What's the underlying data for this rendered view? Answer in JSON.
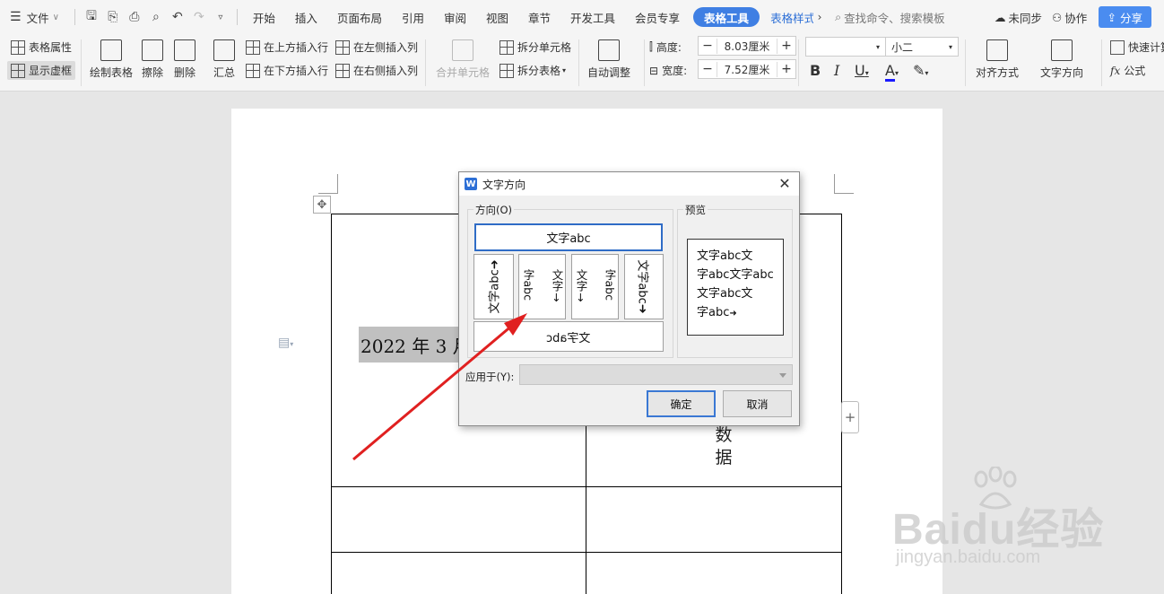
{
  "menubar": {
    "file_label": "文件",
    "tabs": [
      "开始",
      "插入",
      "页面布局",
      "引用",
      "审阅",
      "视图",
      "章节",
      "开发工具",
      "会员专享"
    ],
    "active_tab": "表格工具",
    "next_tab": "表格样式",
    "search_placeholder": "查找命令、搜索模板",
    "sync_label": "未同步",
    "collab_label": "协作",
    "share_label": "分享"
  },
  "ribbon": {
    "table_props": "表格属性",
    "show_gridlines": "显示虚框",
    "draw_table": "绘制表格",
    "erase": "擦除",
    "delete": "删除",
    "summary": "汇总",
    "insert_above": "在上方插入行",
    "insert_below": "在下方插入行",
    "insert_left": "在左侧插入列",
    "insert_right": "在右侧插入列",
    "merge_cells": "合并单元格",
    "split_cells": "拆分单元格",
    "split_table": "拆分表格",
    "auto_adjust": "自动调整",
    "height_label": "高度:",
    "height_value": "8.03厘米",
    "width_label": "宽度:",
    "width_value": "7.52厘米",
    "font_name": "",
    "font_size": "小二",
    "align": "对齐方式",
    "text_direction": "文字方向",
    "quick_calc": "快速计算",
    "formula": "公式"
  },
  "document": {
    "selected_text": "2022 年 3 月",
    "vertical_text": [
      "数",
      "据"
    ]
  },
  "dialog": {
    "title": "文字方向",
    "direction_group": "方向(O)",
    "preview_group": "预览",
    "opt_horizontal": "文字abc",
    "opt_rot_left": "文字abc",
    "opt_vert_col1": "文字",
    "opt_vert_col2": "字abc",
    "opt_vert2_col1": "文字",
    "opt_vert2_col2": "字abc",
    "opt_rot_right": "文字abc",
    "opt_mirror": "文字abc",
    "preview_lines": [
      "文字abc文",
      "字abc文字abc",
      "文字abc文",
      "字abc"
    ],
    "apply_label": "应用于(Y):",
    "apply_value": "",
    "ok_label": "确定",
    "cancel_label": "取消"
  },
  "watermark": {
    "main": "Baidu经验",
    "sub": "jingyan.baidu.com"
  },
  "colors": {
    "accent": "#3f7fe3",
    "selected_border": "#2f6cc6",
    "arrow": "#e02020"
  }
}
